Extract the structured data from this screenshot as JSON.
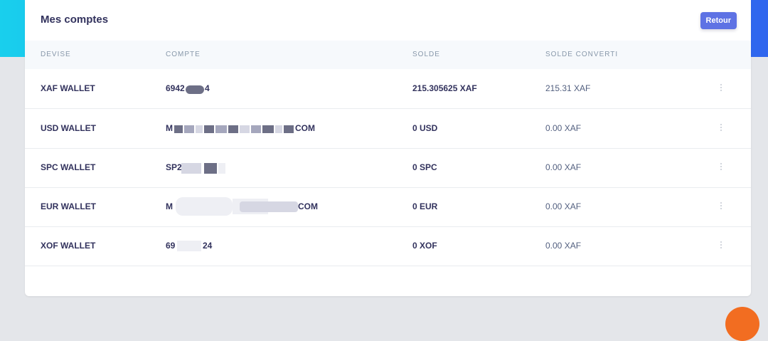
{
  "page": {
    "title": "Mes comptes",
    "back_label": "Retour"
  },
  "columns": [
    "DEVISE",
    "COMPTE",
    "SOLDE",
    "SOLDE CONVERTI"
  ],
  "rows": [
    {
      "devise": "XAF WALLET",
      "compte": "6942 4",
      "solde": "215.305625 XAF",
      "converti": "215.31 XAF"
    },
    {
      "devise": "USD WALLET",
      "compte": "M COM",
      "solde": "0 USD",
      "converti": "0.00 XAF"
    },
    {
      "devise": "SPC WALLET",
      "compte": "SP2",
      "solde": "0 SPC",
      "converti": "0.00 XAF"
    },
    {
      "devise": "EUR WALLET",
      "compte": "M COM",
      "solde": "0 EUR",
      "converti": "0.00 XAF"
    },
    {
      "devise": "XOF WALLET",
      "compte": "69 24",
      "solde": "0 XOF",
      "converti": "0.00 XAF"
    }
  ],
  "colors": {
    "accent": "#5e72e4",
    "header_start": "#19cfed",
    "header_end": "#2f65ee",
    "fab": "#f26d21"
  },
  "icons": {
    "row_menu": "vertical-ellipsis-icon"
  }
}
